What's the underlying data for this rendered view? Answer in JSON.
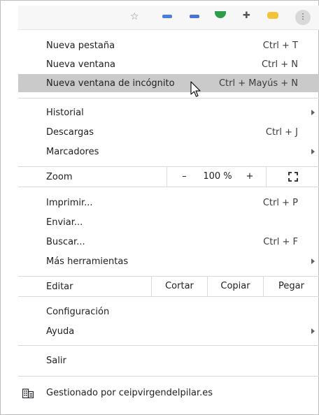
{
  "toolbar": {
    "icons": [
      "star-icon",
      "extension-blue-icon",
      "extension-blue2-icon",
      "extension-green-icon",
      "puzzle-icon",
      "extension-yellow-icon",
      "kebab-menu-icon"
    ]
  },
  "menu": {
    "new_tab": {
      "label": "Nueva pestaña",
      "shortcut": "Ctrl + T"
    },
    "new_window": {
      "label": "Nueva ventana",
      "shortcut": "Ctrl + N"
    },
    "incognito": {
      "label": "Nueva ventana de incógnito",
      "shortcut": "Ctrl + Mayús + N"
    },
    "history": {
      "label": "Historial"
    },
    "downloads": {
      "label": "Descargas",
      "shortcut": "Ctrl + J"
    },
    "bookmarks": {
      "label": "Marcadores"
    },
    "zoom": {
      "label": "Zoom",
      "minus": "–",
      "value": "100 %",
      "plus": "+"
    },
    "print": {
      "label": "Imprimir...",
      "shortcut": "Ctrl + P"
    },
    "cast": {
      "label": "Enviar..."
    },
    "find": {
      "label": "Buscar...",
      "shortcut": "Ctrl + F"
    },
    "more_tools": {
      "label": "Más herramientas"
    },
    "edit": {
      "label": "Editar",
      "cut": "Cortar",
      "copy": "Copiar",
      "paste": "Pegar"
    },
    "settings": {
      "label": "Configuración"
    },
    "help": {
      "label": "Ayuda"
    },
    "exit": {
      "label": "Salir"
    },
    "managed": {
      "label": "Gestionado por ceipvirgendelpilar.es"
    }
  },
  "colors": {
    "highlight": "#cacaca",
    "separator": "#dadada"
  }
}
